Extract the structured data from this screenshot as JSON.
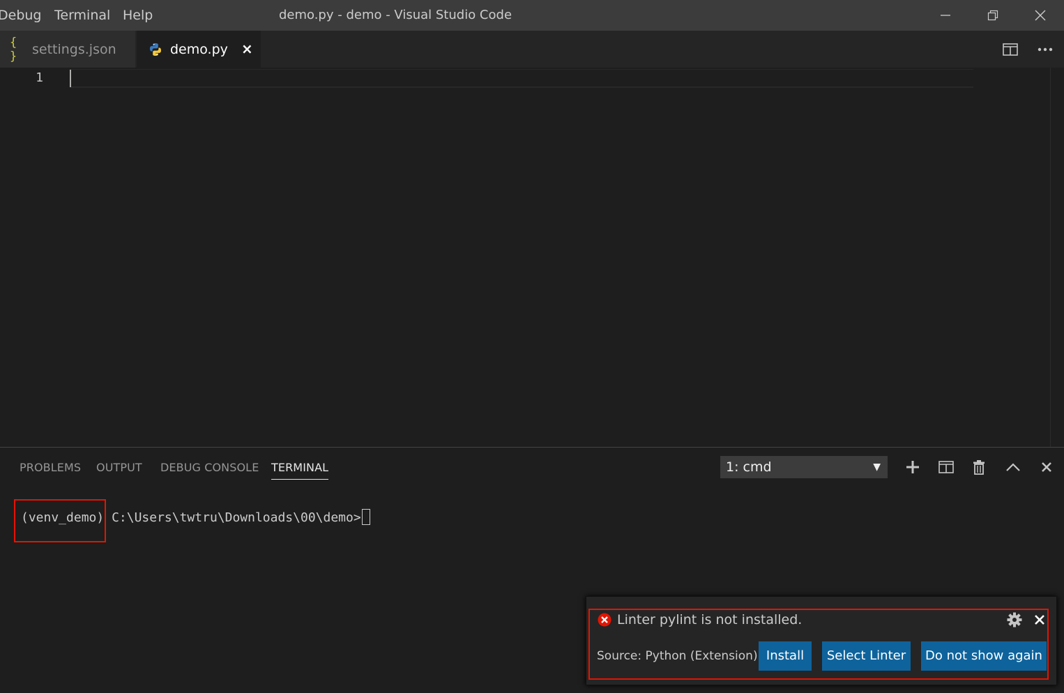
{
  "titlebar": {
    "menu": [
      "Debug",
      "Terminal",
      "Help"
    ],
    "title": "demo.py - demo - Visual Studio Code"
  },
  "tabs": [
    {
      "label": "settings.json",
      "icon": "json-braces-icon",
      "icon_glyph": "{ }",
      "active": false
    },
    {
      "label": "demo.py",
      "icon": "python-icon",
      "active": true,
      "close": "×"
    }
  ],
  "editor": {
    "line_numbers": [
      "1"
    ]
  },
  "panel": {
    "tabs": [
      "PROBLEMS",
      "OUTPUT",
      "DEBUG CONSOLE",
      "TERMINAL"
    ],
    "active_tab": "TERMINAL",
    "terminal_select": "1: cmd",
    "terminal": {
      "env": "(venv_demo)",
      "path": "C:\\Users\\twtru\\Downloads\\00\\demo>"
    }
  },
  "notification": {
    "message": "Linter pylint is not installed.",
    "source": "Source: Python (Extension)",
    "buttons": [
      "Install",
      "Select Linter",
      "Do not show again"
    ]
  },
  "colors": {
    "accent_button": "#0e639c",
    "highlight_red": "#e51400",
    "error_icon": "#e51400",
    "json_icon": "#cbcb41"
  }
}
